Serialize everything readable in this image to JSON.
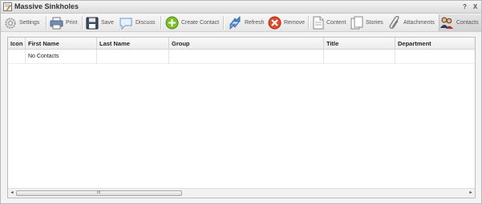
{
  "window": {
    "title": "Massive Sinkholes",
    "help_label": "?",
    "close_label": "X"
  },
  "toolbar": {
    "settings": "Settings",
    "print": "Print",
    "save": "Save",
    "discuss": "Discuss",
    "create_contact": "Create Contact",
    "refresh": "Refresh",
    "remove": "Remove",
    "content": "Content",
    "stories": "Stories",
    "attachments": "Attachments",
    "contacts": "Contacts"
  },
  "grid": {
    "columns": [
      "Icon",
      "First Name",
      "Last Name",
      "Group",
      "Title",
      "Department"
    ],
    "rows": [
      [
        "",
        "No Contacts",
        "",
        "",
        "",
        ""
      ]
    ]
  },
  "scrollbar": {
    "grip": "III",
    "left_arrow": "◂",
    "right_arrow": "▸"
  },
  "colors": {
    "create_contact_icon": "#7bbf2a",
    "remove_icon": "#e04a2a",
    "refresh_icon": "#3a7fd0"
  }
}
